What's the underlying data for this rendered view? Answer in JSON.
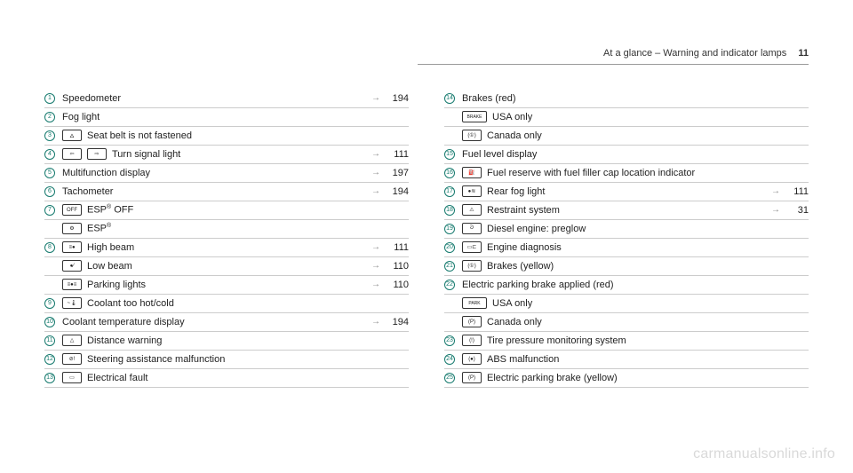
{
  "header": {
    "title": "At a glance – Warning and indicator lamps",
    "page": "11"
  },
  "watermark": "carmanualsonline.info",
  "left": [
    {
      "n": "1",
      "icons": [],
      "label": "Speedometer",
      "page": "194"
    },
    {
      "n": "2",
      "icons": [],
      "label": "Fog light"
    },
    {
      "n": "3",
      "icons": [
        "seatbelt"
      ],
      "label": "Seat belt is not fastened"
    },
    {
      "n": "4",
      "icons": [
        "turn-l",
        "turn-r"
      ],
      "label": "Turn signal light",
      "page": "111"
    },
    {
      "n": "5",
      "icons": [],
      "label": "Multifunction display",
      "page": "197"
    },
    {
      "n": "6",
      "icons": [],
      "label": "Tachometer",
      "page": "194"
    },
    {
      "n": "7",
      "icons": [
        "esp-off"
      ],
      "label": "ESP® OFF",
      "sup": true
    },
    {
      "n": "",
      "icons": [
        "esp"
      ],
      "label": "ESP®",
      "sup": true
    },
    {
      "n": "8",
      "icons": [
        "high-beam"
      ],
      "label": "High beam",
      "page": "111"
    },
    {
      "n": "",
      "icons": [
        "low-beam"
      ],
      "label": "Low beam",
      "page": "110"
    },
    {
      "n": "",
      "icons": [
        "parking-lights"
      ],
      "label": "Parking lights",
      "page": "110"
    },
    {
      "n": "9",
      "icons": [
        "coolant"
      ],
      "label": "Coolant too hot/cold"
    },
    {
      "n": "10",
      "icons": [],
      "label": "Coolant temperature display",
      "page": "194"
    },
    {
      "n": "11",
      "icons": [
        "distance"
      ],
      "label": "Distance warning"
    },
    {
      "n": "12",
      "icons": [
        "steering"
      ],
      "label": "Steering assistance malfunction"
    },
    {
      "n": "13",
      "icons": [
        "battery"
      ],
      "label": "Electrical fault"
    }
  ],
  "right": [
    {
      "n": "14",
      "icons": [],
      "label": "Brakes (red)"
    },
    {
      "n": "",
      "icons": [
        "brake-usa"
      ],
      "label": "USA only"
    },
    {
      "n": "",
      "icons": [
        "brake-can"
      ],
      "label": "Canada only"
    },
    {
      "n": "15",
      "icons": [],
      "label": "Fuel level display"
    },
    {
      "n": "16",
      "icons": [
        "fuel"
      ],
      "label": "Fuel reserve with fuel filler cap location indicator"
    },
    {
      "n": "17",
      "icons": [
        "rear-fog"
      ],
      "label": "Rear fog light",
      "page": "111"
    },
    {
      "n": "18",
      "icons": [
        "restraint"
      ],
      "label": "Restraint system",
      "page": "31"
    },
    {
      "n": "19",
      "icons": [
        "preglow"
      ],
      "label": "Diesel engine: preglow"
    },
    {
      "n": "20",
      "icons": [
        "engine"
      ],
      "label": "Engine diagnosis"
    },
    {
      "n": "21",
      "icons": [
        "brake-yel"
      ],
      "label": "Brakes (yellow)"
    },
    {
      "n": "22",
      "icons": [],
      "label": "Electric parking brake applied (red)"
    },
    {
      "n": "",
      "icons": [
        "park-usa"
      ],
      "label": "USA only"
    },
    {
      "n": "",
      "icons": [
        "park-can"
      ],
      "label": "Canada only"
    },
    {
      "n": "23",
      "icons": [
        "tpms"
      ],
      "label": "Tire pressure monitoring system"
    },
    {
      "n": "24",
      "icons": [
        "abs"
      ],
      "label": "ABS malfunction"
    },
    {
      "n": "25",
      "icons": [
        "park-yel"
      ],
      "label": "Electric parking brake (yellow)"
    }
  ],
  "icon_glyphs": {
    "seatbelt": "🜂",
    "turn-l": "⇦",
    "turn-r": "⇨",
    "esp-off": "OFF",
    "esp": "⚙",
    "high-beam": "≡●",
    "low-beam": "●⁄",
    "parking-lights": "≡●≡",
    "coolant": "~🌡",
    "distance": "△",
    "steering": "⊘!",
    "battery": "▭",
    "brake-usa": "BRAKE",
    "brake-can": "(①)",
    "fuel": "⛽",
    "rear-fog": "●≋",
    "restraint": "⚠",
    "preglow": "ᘒ",
    "engine": "▭⊏",
    "brake-yel": "(①)",
    "park-usa": "PARK",
    "park-can": "(P)",
    "tpms": "(!)",
    "abs": "(●)",
    "park-yel": "(P)"
  }
}
